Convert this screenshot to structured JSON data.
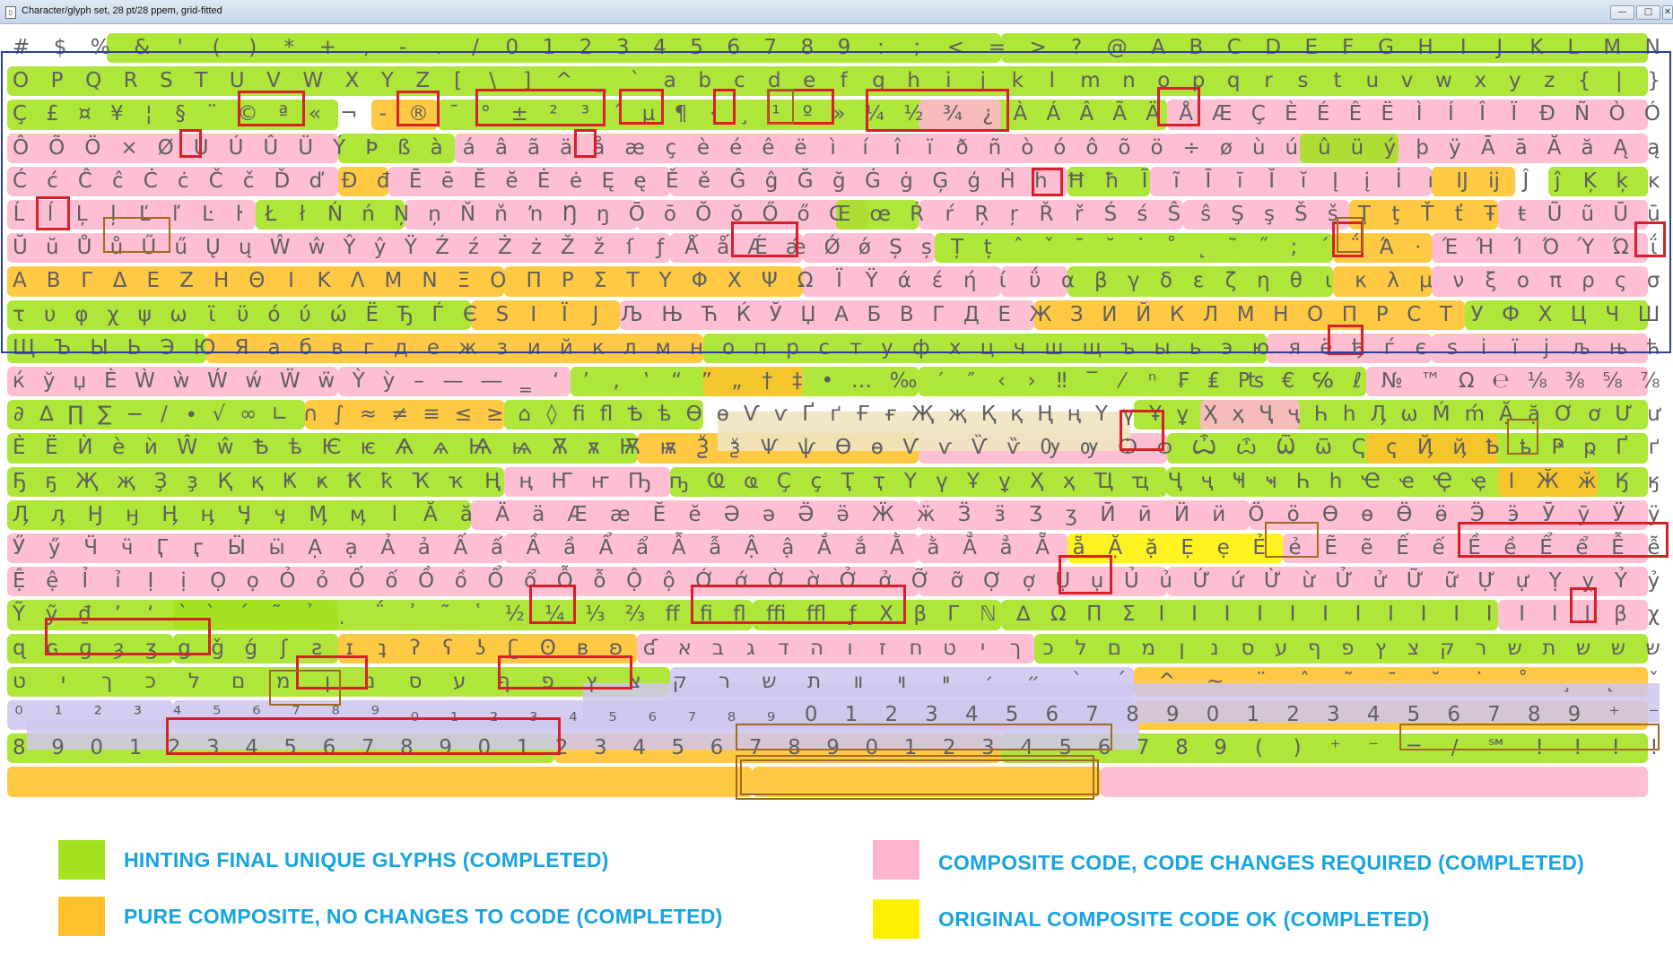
{
  "window": {
    "title": "Character/glyph set, 28 pt/28 ppem, grid-fitted",
    "buttons": {
      "minimize": "—",
      "maximize": "□",
      "close": "✕"
    }
  },
  "colors": {
    "green": "#a3e21e",
    "orange": "#ffc12a",
    "pink": "#ffb6cc",
    "yellow": "#fff000",
    "lavender": "#cfc6ef",
    "beige": "#efe3c0",
    "red_outline": "#d8202a",
    "selection_outline": "#2b3ea0",
    "legend_text": "#18a4e0"
  },
  "glyph_rows": [
    "# $ % & ' ( ) * + , - . / 0 1 2 3 4 5 6 7 8 9 : ; < = > ? @ A B C D E F G H I J K L M N",
    "O P Q R S T U V W X Y Z [ \\ ] ^ _ ` a b c d e f g h i j k l m n o p q r s t u v w x y z { | }",
    "Ç £ ¤ ¥ ¦ § ¨ © ª « ¬ - ® ¯ ° ± ² ³ ´ µ ¶ · ¸ ¹ º » ¼ ½ ¾ ¿ À Á Â Ã Ä Å Æ Ç È É Ê Ë Ì Í Î Ï Ð Ñ Ò Ó",
    "Ô Õ Ö × Ø Ù Ú Û Ü Ý Þ ß à á â ã ä å æ ç è é ê ë ì í î ï ð ñ ò ó ô õ ö ÷ ø ù ú û ü ý þ ÿ Ā ā Ă ă Ą ą",
    "Ć ć Ĉ ĉ Ċ ċ Č č Ď ď Đ đ Ē ē Ĕ ĕ Ė ė Ę ę Ě ě Ĝ ĝ Ğ ğ Ġ ġ Ģ ģ Ĥ ĥ Ħ ħ Ĩ ĩ Ī ī Ĭ ĭ Į į İ ı Ĳ ĳ Ĵ ĵ Ķ ķ ĸ",
    "Ĺ ĺ Ļ ļ Ľ ľ Ŀ ŀ Ł ł Ń ń Ņ ņ Ň ň ŉ Ŋ ŋ Ō ō Ŏ ŏ Ő ő Œ œ Ŕ ŕ Ŗ ŗ Ř ř Ś ś Ŝ ŝ Ş ş Š š Ţ ţ Ť ť Ŧ ŧ Ũ ũ Ū ū",
    "Ŭ ŭ Ů ů Ű ű Ų ų Ŵ ŵ Ŷ ŷ Ÿ Ź ź Ż ż Ž ž ſ ƒ Ǻ ǻ Ǽ ǽ Ǿ ǿ Ș ș Ț ț ˆ ˇ ˉ ˘ ˙ ˚ ˛ ˜ ˝ ; ΄ ΅ Ά · Έ Ή Ί Ό Ύ Ώ ΐ",
    "Α Β Γ Δ Ε Ζ Η Θ Ι Κ Λ Μ Ν Ξ Ο Π Ρ Σ Τ Υ Φ Χ Ψ Ω Ϊ Ϋ ά έ ή ί ΰ α β γ δ ε ζ η θ ι κ λ μ ν ξ ο π ρ ς σ",
    "τ υ φ χ ψ ω ϊ ϋ ό ύ ώ Ё Ђ Ѓ Є Ѕ І Ї Ј Љ Њ Ћ Ќ Ў Џ А Б В Г Д Е Ж З И Й К Л М Н О П Р С Т У Ф Х Ц Ч Ш",
    "Щ Ъ Ы Ь Э Ю Я а б в г д е ж з и й к л м н о п р с т у ф х ц ч ш щ ъ ы ь э ю я ё ђ ѓ є ѕ і ї ј љ њ ћ",
    "ќ ў џ Ѐ Ẁ ẁ Ẃ ẃ Ẅ ẅ Ỳ ỳ – — ― ‗ ‘ ’ ‚ ‛ “ ” „ † ‡ • … ‰ ′ ″ ‹ › ‼ ‾ ⁄ ⁿ ₣ ₤ ₧ € ℅ ℓ № ™ Ω ℮ ⅛ ⅜ ⅝ ⅞",
    "∂ ∆ ∏ ∑ − ∕ ∙ √ ∞ ∟ ∩ ∫ ≈ ≠ ≡ ≤ ≥ ⌂ ◊ ﬁ ﬂ Ѣ ѣ Ѳ ѳ Ѵ ѵ Ґ ґ Ғ ғ Җ җ Қ қ Ң ң Ү ү Ұ ұ Ҳ ҳ Ҷ ҷ Һ һ Ӆ ω Ḿ ḿ Ặ ặ Ơ ơ Ư ư",
    "Ѐ Ё Ѝ ѐ ѝ Ŵ ŵ Ѣ ѣ Ѥ ѥ Ѧ ѧ Ѩ ѩ Ѫ ѫ Ѭ ѭ Ѯ ѯ Ѱ ѱ Ѳ ѳ Ѵ ѵ Ѷ ѷ Ѹ ѹ Ѻ ѻ Ѽ ѽ Ѿ ѿ Ҁ ҁ Ҋ ҋ Ҍ ҍ Ҏ ҏ Ґ ґ",
    "Ҕ ҕ Җ җ Ҙ ҙ Қ қ Ҝ ҝ Ҟ ҟ Ҡ ҡ Ң ң Ҥ ҥ Ҧ ҧ Ҩ ҩ Ҫ ҫ Ҭ ҭ Ү ү Ұ ұ Ҳ ҳ Ҵ ҵ Ҷ ҷ Ҹ ҹ Һ һ Ҽ ҽ Ҿ ҿ Ӏ Ӂ ӂ Ӄ ӄ",
    "Ӆ ӆ Ӈ ӈ Ӊ ӊ Ӌ ӌ Ӎ ӎ ӏ Ӑ ӑ Ӓ ӓ Ӕ ӕ Ӗ ӗ Ә ә Ӛ ӛ Ӝ ӝ Ӟ ӟ Ӡ ӡ Ӣ ӣ Ӥ ӥ Ӧ ӧ Ө ө Ӫ ӫ Ӭ ӭ Ӯ ӯ Ӱ ӱ",
    "Ӳ ӳ Ӵ ӵ Ӷ ӷ Ӹ ӹ Ạ ạ Ả ả Ấ ấ Ầ ầ Ẩ ẩ Ẫ ẫ Ậ ậ Ắ ắ Ằ ằ Ẳ ẳ Ẵ ẵ Ặ ặ Ẹ ẹ Ẻ ẻ Ẽ ẽ Ế ế Ề ề Ể ể Ễ ễ",
    "Ệ ệ Ỉ ỉ Ị ị Ọ ọ Ỏ ỏ Ố ố Ồ ồ Ổ ổ Ỗ ỗ Ộ ộ Ớ ớ Ờ ờ Ở ở Ỡ ỡ Ợ ợ Ụ ụ Ủ ủ Ứ ứ Ừ ừ Ử ử Ữ ữ Ự ự Ỵ ỵ Ỷ ỷ",
    "Ỹ ỹ ₫ ʼ ʻ ˋ ̀ ́ ̃ ̉ ̣ ΅ ᾿ ῀ ῾ ½ ¼ ⅓ ⅔ ﬀ ﬁ ﬂ ﬃ ﬄ ƒ Χ β Γ ℕ ∆ Ω Π Σ Ι Ι Ι Ι Ι Ι Ι Ι Ι Ι Ι Ι Ι Ι β χ",
    "ɋ ɢ ɡ ȝ ʒ ǥ ǧ ǵ ʃ ƨ ɪ ʇ ʔ ʕ ʖ ʗ ʘ ʙ ʚ ʛ א ב ג ד ה ו ז ח ט י ך כ ל ם מ ן נ ס ע ף פ ץ צ ק ר ש ת ש ש ש",
    "ט י ך כ ל ם מ ן נ ס ע ף פ ץ צ ק ר ש ת װ ױ ײ ׳ ״ ` ´ ^ ~ ¨ ˆ ˜ ¯ ˘ ˙ ˚ ¸ ˛ ˇ",
    "⁰ ¹ ² ³ ⁴ ⁵ ⁶ ⁷ ⁸ ⁹ ₀ ₁ ₂ ₃ ₄ ₅ ₆ ₇ ₈ ₉ 0 1 2 3 4 5 6 7 8 9 0 1 2 3 4 5 6 7 8 9 ⁺ ⁻",
    "8 9 0 1 2 3 4 5 6 7 8 9 0 1 2 3 4 5 6 7 8 9 0 1 2 3 4 5 6 7 8 9 ( ) ⁺ ⁻ = / ℠ ! ! ! !"
  ],
  "legend": [
    {
      "label": "HINTING FINAL UNIQUE GLYPHS   (COMPLETED)",
      "color": "#a3e21e"
    },
    {
      "label": "PURE COMPOSITE, NO CHANGES TO CODE   (COMPLETED)",
      "color": "#ffc12a"
    },
    {
      "label": "COMPOSITE CODE, CODE CHANGES REQUIRED  (COMPLETED)",
      "color": "#ffb6cc"
    },
    {
      "label": "ORIGINAL COMPOSITE CODE OK  (COMPLETED)",
      "color": "#fff000"
    }
  ]
}
